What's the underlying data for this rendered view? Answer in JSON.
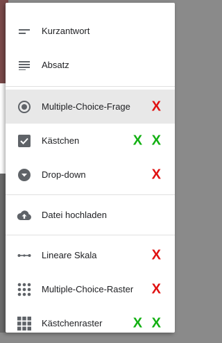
{
  "menu": {
    "items": [
      {
        "label": "Kurzantwort",
        "icon": "short-text-icon",
        "mark": "",
        "mark_color": ""
      },
      {
        "label": "Absatz",
        "icon": "paragraph-icon",
        "mark": "",
        "mark_color": ""
      },
      {
        "label": "Multiple-Choice-Frage",
        "icon": "radio-button-icon",
        "mark": "X",
        "mark_color": "#e01010",
        "selected": true
      },
      {
        "label": "Kästchen",
        "icon": "checkbox-icon",
        "mark": "X X",
        "mark_color": "#12b012"
      },
      {
        "label": "Drop-down",
        "icon": "dropdown-icon",
        "mark": "X",
        "mark_color": "#e01010"
      },
      {
        "label": "Datei hochladen",
        "icon": "cloud-upload-icon",
        "mark": "",
        "mark_color": ""
      },
      {
        "label": "Lineare Skala",
        "icon": "linear-scale-icon",
        "mark": "X",
        "mark_color": "#e01010"
      },
      {
        "label": "Multiple-Choice-Raster",
        "icon": "radio-grid-icon",
        "mark": "X",
        "mark_color": "#e01010"
      },
      {
        "label": "Kästchenraster",
        "icon": "checkbox-grid-icon",
        "mark": "X X",
        "mark_color": "#12b012"
      }
    ]
  },
  "colors": {
    "icon": "#5f6368",
    "selected_bg": "#e8e8e8",
    "red_mark": "#e01010",
    "green_mark": "#12b012"
  }
}
